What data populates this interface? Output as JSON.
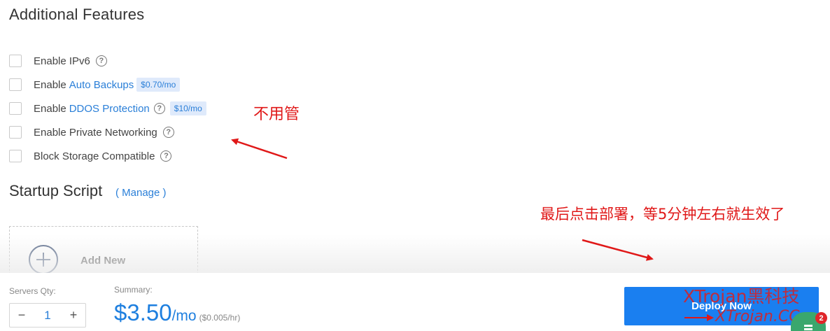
{
  "additional_features": {
    "title": "Additional Features",
    "items": [
      {
        "prefix": "Enable IPv6",
        "link": "",
        "badge": "",
        "help": true
      },
      {
        "prefix": "Enable",
        "link": "Auto Backups",
        "badge": "$0.70/mo",
        "help": false
      },
      {
        "prefix": "Enable",
        "link": "DDOS Protection",
        "badge": "$10/mo",
        "help": true
      },
      {
        "prefix": "Enable Private Networking",
        "link": "",
        "badge": "",
        "help": true
      },
      {
        "prefix": "Block Storage Compatible",
        "link": "",
        "badge": "",
        "help": true
      }
    ]
  },
  "annotations": {
    "no_need": "不用管",
    "deploy_hint": "最后点击部署，等5分钟左右就生效了"
  },
  "startup_script": {
    "title": "Startup Script",
    "manage_link": "( Manage )",
    "add_new": "Add New"
  },
  "bottom_bar": {
    "servers_qty_label": "Servers Qty:",
    "qty_minus": "−",
    "qty_value": "1",
    "qty_plus": "+",
    "summary_label": "Summary:",
    "price_main": "$3.50",
    "price_unit": "/mo",
    "price_hourly": "($0.005/hr)",
    "deploy_label": "Deploy Now"
  },
  "watermark": {
    "line1": "XTrojan黑科技",
    "line2": "XTrojan.CC"
  },
  "chat_widget": {
    "badge_count": "2"
  },
  "colors": {
    "accent": "#1a7ff0",
    "link": "#2a7fd8",
    "annotation": "#e01818",
    "chat": "#3aa76d"
  }
}
